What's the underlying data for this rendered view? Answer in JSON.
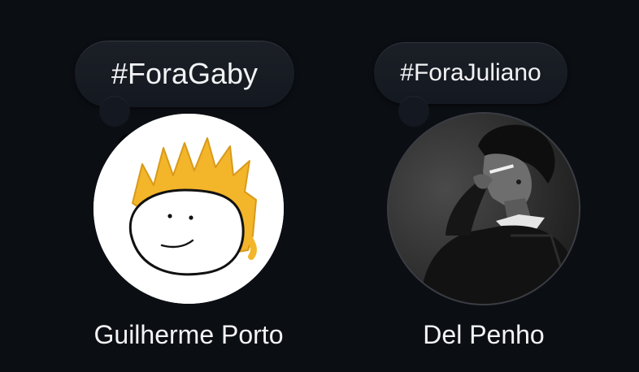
{
  "notes": [
    {
      "text": "#ForaGaby",
      "user_name": "Guilherme Porto",
      "avatar_icon": "cartoon-face-avatar"
    },
    {
      "text": "#ForaJuliano",
      "user_name": "Del Penho",
      "avatar_icon": "person-smoking-photo-avatar"
    }
  ],
  "colors": {
    "background": "#0b0e13",
    "bubble": "#1b1f26",
    "text": "#f4f4f6",
    "hair_accent": "#f3b52a"
  }
}
